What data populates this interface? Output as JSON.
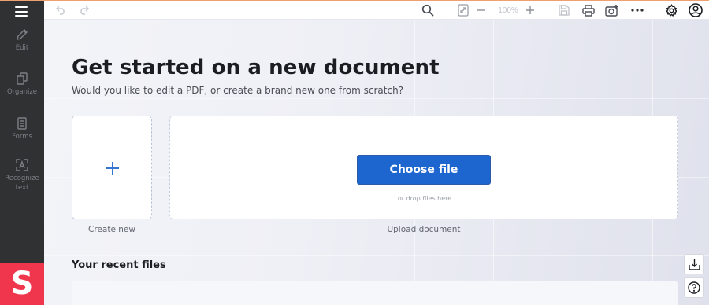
{
  "sidebar": {
    "logo_letter": "S",
    "items": [
      {
        "label": "Edit",
        "icon": "pencil-icon"
      },
      {
        "label": "Organize",
        "icon": "organize-pages-icon"
      },
      {
        "label": "Forms",
        "icon": "form-document-icon"
      },
      {
        "label": "Recognize text",
        "icon": "ocr-text-icon"
      }
    ]
  },
  "toolbar": {
    "zoom": "100%",
    "icons": [
      "undo-icon",
      "redo-icon",
      "search-icon",
      "fit-page-icon",
      "zoom-out-icon",
      "zoom-in-icon",
      "save-icon",
      "print-icon",
      "add-image-icon",
      "more-icon",
      "settings-icon",
      "account-icon"
    ]
  },
  "main": {
    "title": "Get started on a new document",
    "subtitle": "Would you like to edit a PDF, or create a brand new one from scratch?",
    "create_caption": "Create new",
    "choose_file_label": "Choose file",
    "drop_hint": "or drop files here",
    "upload_caption": "Upload document",
    "recent_title": "Your recent files"
  },
  "floating": [
    "download-icon",
    "help-icon"
  ],
  "colors": {
    "sidebar_bg": "#2f3133",
    "logo_bg": "#f0364c",
    "primary": "#1e66cf",
    "plus": "#3575d0"
  }
}
